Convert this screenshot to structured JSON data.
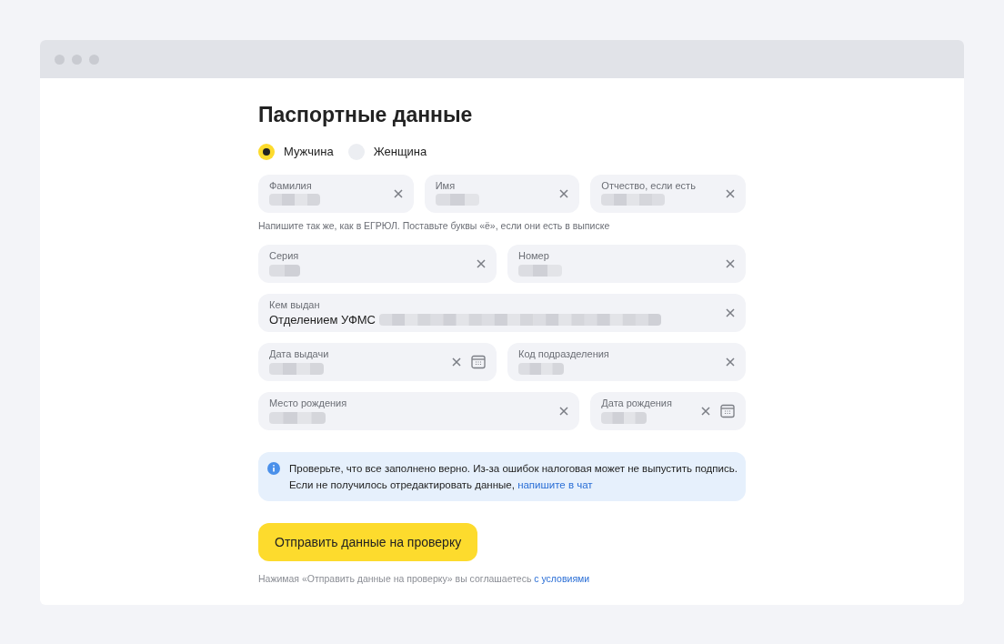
{
  "title": "Паспортные данные",
  "gender": [
    {
      "label": "Мужчина",
      "selected": true
    },
    {
      "label": "Женщина",
      "selected": false
    }
  ],
  "field_rows": [
    {
      "fields": [
        {
          "label": "Фамилия",
          "redacted": true,
          "calendar": false
        },
        {
          "label": "Имя",
          "redacted": true,
          "calendar": false
        },
        {
          "label": "Отчество, если есть",
          "redacted": true,
          "calendar": false
        }
      ],
      "hint": "Напишите так же, как в ЕГРЮЛ. Поставьте буквы «ё», если они есть в выписке"
    },
    {
      "fields": [
        {
          "label": "Серия",
          "redacted": true,
          "calendar": false
        },
        {
          "label": "Номер",
          "redacted": true,
          "calendar": false
        }
      ]
    },
    {
      "fields": [
        {
          "label": "Кем выдан",
          "value": "Отделением УФМС",
          "redacted": true,
          "calendar": false
        }
      ]
    },
    {
      "fields": [
        {
          "label": "Дата выдачи",
          "redacted": true,
          "calendar": true
        },
        {
          "label": "Код подразделения",
          "redacted": true,
          "calendar": false
        }
      ]
    },
    {
      "fields": [
        {
          "label": "Место рождения",
          "redacted": true,
          "calendar": false
        },
        {
          "label": "Дата рождения",
          "redacted": true,
          "calendar": true
        }
      ]
    }
  ],
  "notice": {
    "text": "Проверьте, что все заполнено верно. Из-за ошибок налоговая может не выпустить подпись.",
    "text2": "Если не получилось отредактировать данные,",
    "link": "напишите в чат"
  },
  "submit": "Отправить данные на проверку",
  "footnote": {
    "text": "Нажимая «Отправить данные на проверку» вы соглашаетесь",
    "link": "с условиями"
  }
}
